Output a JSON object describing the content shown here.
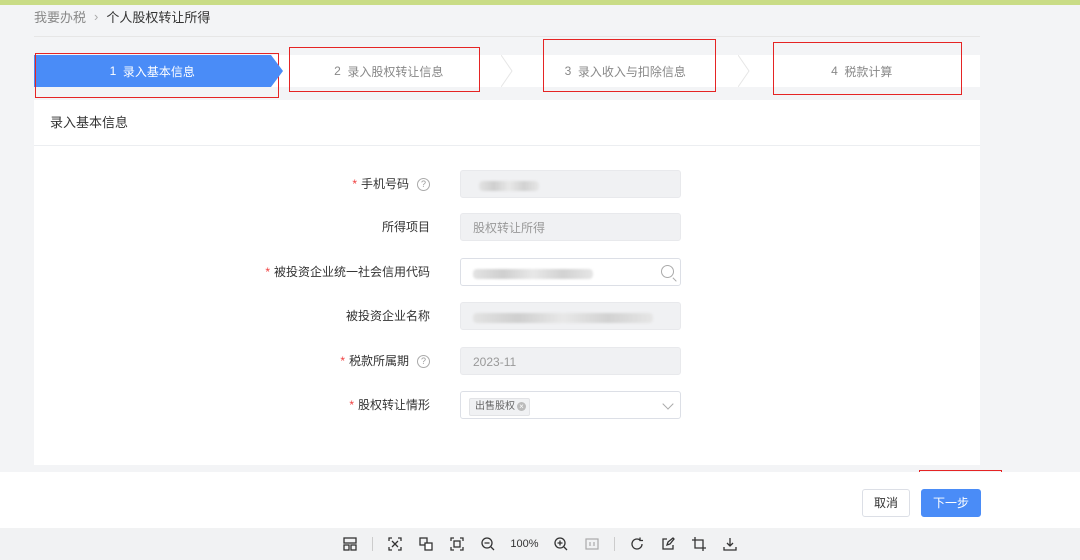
{
  "breadcrumb": {
    "parent": "我要办税",
    "separator": "›",
    "current": "个人股权转让所得"
  },
  "steps": [
    {
      "num": "1",
      "label": "录入基本信息"
    },
    {
      "num": "2",
      "label": "录入股权转让信息"
    },
    {
      "num": "3",
      "label": "录入收入与扣除信息"
    },
    {
      "num": "4",
      "label": "税款计算"
    }
  ],
  "active_step": 1,
  "card_title": "录入基本信息",
  "form": {
    "phone_label": "手机号码",
    "income_item_label": "所得项目",
    "income_item_value": "股权转让所得",
    "credit_code_label": "被投资企业统一社会信用代码",
    "company_name_label": "被投资企业名称",
    "tax_period_label": "税款所属期",
    "tax_period_value": "2023-11",
    "transfer_type_label": "股权转让情形",
    "transfer_type_tag": "出售股权",
    "required_mark": "*",
    "help_mark": "?"
  },
  "footer": {
    "cancel_label": "取消",
    "next_label": "下一步"
  },
  "viewer_toolbar": {
    "zoom": "100%"
  },
  "colors": {
    "accent": "#4a8cf7",
    "required": "#f04040",
    "annotation_red": "#e52424"
  }
}
